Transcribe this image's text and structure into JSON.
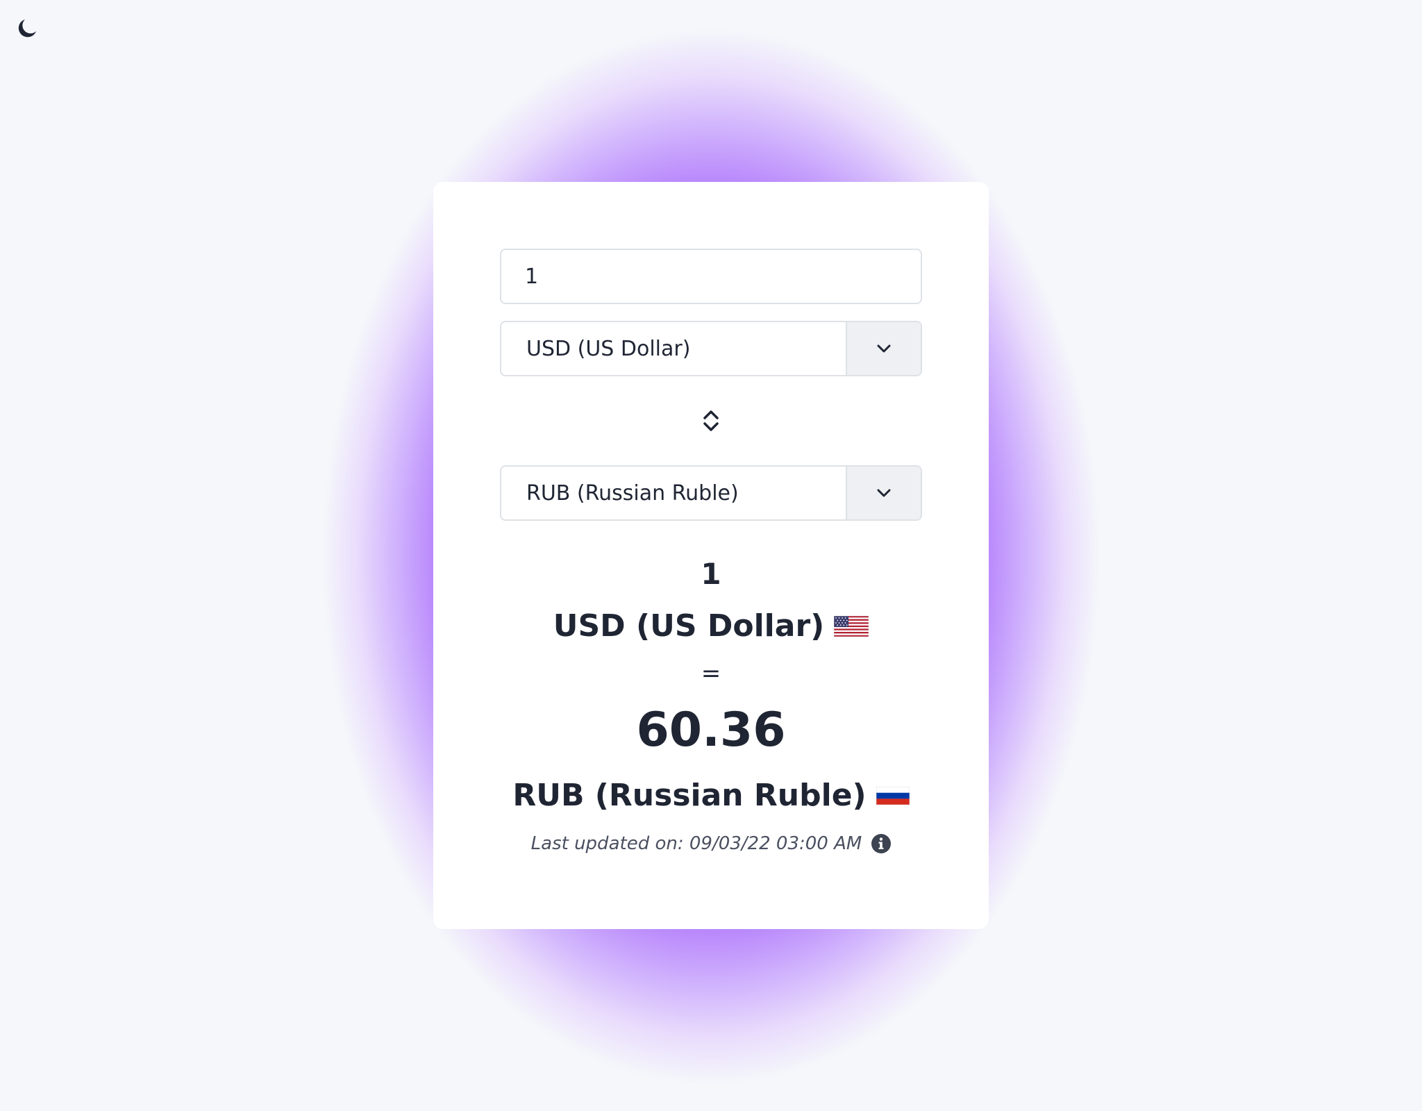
{
  "header": {
    "theme_toggle_icon": "moon-icon"
  },
  "converter": {
    "amount_value": "1",
    "from_currency": "USD (US Dollar)",
    "to_currency": "RUB (Russian Ruble)",
    "dropdown_icon": "chevron-down-icon",
    "swap_icon": "swap-vertical-icon"
  },
  "result": {
    "amount": "1",
    "from_currency": "USD (US Dollar)",
    "from_flag": "us-flag-icon",
    "equals": "=",
    "value": "60.36",
    "to_currency": "RUB (Russian Ruble)",
    "to_flag": "ru-flag-icon",
    "last_updated": "Last updated on: 09/03/22 03:00 AM",
    "info_icon": "info-icon"
  },
  "colors": {
    "accent_glow": "#a765fb",
    "page_background": "#f5f7fb",
    "card_background": "#ffffff",
    "text_primary": "#1f2533",
    "select_button_bg": "#eef0f3",
    "border": "#dee2e6"
  }
}
